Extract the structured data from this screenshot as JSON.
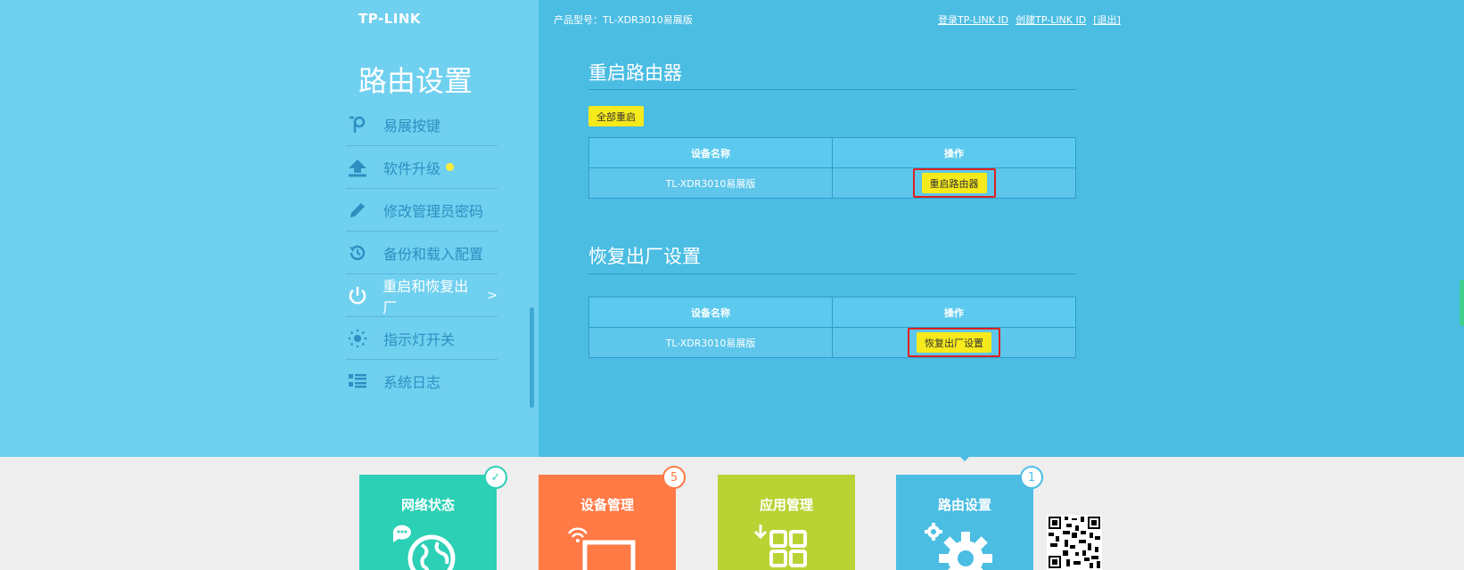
{
  "header": {
    "logo": "TP-LINK",
    "product_label": "产品型号：TL-XDR3010易展版",
    "links": [
      "登录TP-LINK ID",
      "创建TP-LINK ID",
      "[退出]"
    ]
  },
  "sidebar": {
    "title": "路由设置",
    "items": [
      {
        "label": "易展按键",
        "icon": "easy-mesh-icon"
      },
      {
        "label": "软件升级",
        "icon": "upload-icon",
        "has_dot": true
      },
      {
        "label": "修改管理员密码",
        "icon": "pencil-icon"
      },
      {
        "label": "备份和载入配置",
        "icon": "history-icon"
      },
      {
        "label": "重启和恢复出厂",
        "icon": "power-icon",
        "active": true,
        "arrow": ">"
      },
      {
        "label": "指示灯开关",
        "icon": "led-icon"
      },
      {
        "label": "系统日志",
        "icon": "list-icon"
      }
    ]
  },
  "reboot_section": {
    "title": "重启路由器",
    "all_button": "全部重启",
    "table": {
      "headers": [
        "设备名称",
        "操作"
      ],
      "rows": [
        {
          "device": "TL-XDR3010易展版",
          "action": "重启路由器"
        }
      ]
    }
  },
  "factory_section": {
    "title": "恢复出厂设置",
    "table": {
      "headers": [
        "设备名称",
        "操作"
      ],
      "rows": [
        {
          "device": "TL-XDR3010易展版",
          "action": "恢复出厂设置"
        }
      ]
    }
  },
  "bottom_nav": {
    "tiles": [
      {
        "label": "网络状态",
        "color": "#2bd0b5",
        "badge": "✓",
        "badge_color": "#2bd0b5"
      },
      {
        "label": "设备管理",
        "color": "#ff7a45",
        "badge": "5",
        "badge_color": "#ff7a45"
      },
      {
        "label": "应用管理",
        "color": "#b9d335",
        "badge": "",
        "badge_color": ""
      },
      {
        "label": "路由设置",
        "color": "#4bbde3",
        "badge": "1",
        "badge_color": "#4bbde3"
      }
    ]
  },
  "colors": {
    "left_panel": "#70d0ef",
    "main_panel": "#4bbde3",
    "button_yellow": "#f6e91c",
    "highlight_red": "#e02020"
  }
}
